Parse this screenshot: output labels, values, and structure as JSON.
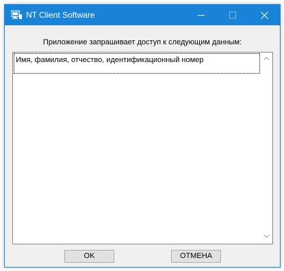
{
  "window": {
    "title": "NT Client Software",
    "app_icon": "app-icon",
    "controls": {
      "minimize_icon": "minimize-icon",
      "maximize_icon": "maximize-icon",
      "close_icon": "close-icon"
    },
    "accent_color": "#1883d7"
  },
  "dialog": {
    "prompt": "Приложение запрашивает доступ к следующим данным:",
    "items": [
      "Имя, фамилия, отчество, идентификационный номер"
    ],
    "scrollbar": {
      "up_icon": "chevron-up-icon",
      "down_icon": "chevron-down-icon"
    }
  },
  "buttons": {
    "ok_label": "OK",
    "cancel_label": "ОТМЕНА"
  }
}
